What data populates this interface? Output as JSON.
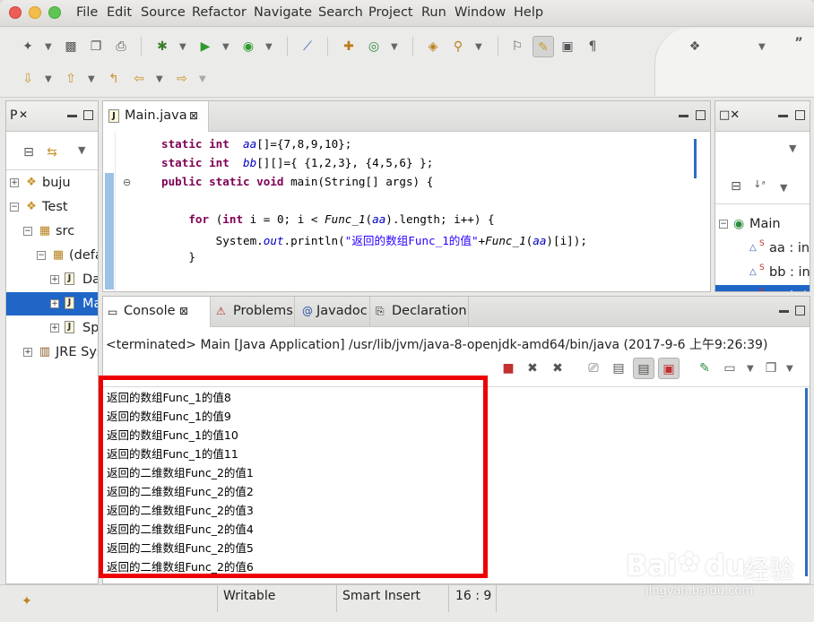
{
  "menu": [
    "File",
    "Edit",
    "Source",
    "Refactor",
    "Navigate",
    "Search",
    "Project",
    "Run",
    "Window",
    "Help"
  ],
  "left_panel": {
    "tab_label": "P",
    "tree": [
      {
        "label": "buju",
        "level": 0,
        "expander": "+"
      },
      {
        "label": "Test",
        "level": 0,
        "expander": "−"
      },
      {
        "label": "src",
        "level": 1,
        "expander": "−"
      },
      {
        "label": "(defa",
        "level": 2,
        "expander": "−"
      },
      {
        "label": "Da",
        "level": 3,
        "expander": "+"
      },
      {
        "label": "Ma",
        "level": 3,
        "expander": "+",
        "selected": true
      },
      {
        "label": "Sp",
        "level": 3,
        "expander": "+"
      },
      {
        "label": "JRE Sys",
        "level": 1,
        "expander": "+"
      }
    ]
  },
  "editor": {
    "tab_label": "Main.java",
    "lines": [
      {
        "segments": [
          {
            "t": "static ",
            "c": "kw"
          },
          {
            "t": "int ",
            "c": "kw"
          },
          {
            "t": " "
          },
          {
            "t": "aa",
            "c": "it"
          },
          {
            "t": "[]={7,8,9,10};"
          }
        ]
      },
      {
        "segments": [
          {
            "t": "static ",
            "c": "kw"
          },
          {
            "t": "int ",
            "c": "kw"
          },
          {
            "t": " "
          },
          {
            "t": "bb",
            "c": "it"
          },
          {
            "t": "[][]={ {1,2,3}, {4,5,6} };"
          }
        ]
      },
      {
        "segments": [
          {
            "t": "public ",
            "c": "kw"
          },
          {
            "t": "static ",
            "c": "kw"
          },
          {
            "t": "void ",
            "c": "kw"
          },
          {
            "t": "main(String[] args) {"
          }
        ]
      },
      {
        "segments": []
      },
      {
        "segments": [
          {
            "t": "    "
          },
          {
            "t": "for ",
            "c": "kw"
          },
          {
            "t": "("
          },
          {
            "t": "int ",
            "c": "kw"
          },
          {
            "t": "i = 0; i < "
          },
          {
            "t": "Func_1",
            "c": "fn"
          },
          {
            "t": "("
          },
          {
            "t": "aa",
            "c": "it"
          },
          {
            "t": ").length; i++) {"
          }
        ]
      },
      {
        "segments": [
          {
            "t": "        System."
          },
          {
            "t": "out",
            "c": "it"
          },
          {
            "t": ".println("
          },
          {
            "t": "\"返回的数组Func_1的值\"",
            "c": "st"
          },
          {
            "t": "+"
          },
          {
            "t": "Func_1",
            "c": "fn"
          },
          {
            "t": "("
          },
          {
            "t": "aa",
            "c": "it"
          },
          {
            "t": ")[i]);"
          }
        ]
      },
      {
        "segments": [
          {
            "t": "    }"
          }
        ]
      }
    ]
  },
  "outline": {
    "items": [
      {
        "label": "Main",
        "prefix": ""
      },
      {
        "label": "aa : in",
        "prefix": "S"
      },
      {
        "label": "bb : in",
        "prefix": "S"
      },
      {
        "label": "main(",
        "prefix": "S"
      }
    ]
  },
  "console": {
    "tabs": [
      "Console",
      "Problems",
      "Javadoc",
      "Declaration"
    ],
    "header": "<terminated> Main [Java Application] /usr/lib/jvm/java-8-openjdk-amd64/bin/java (2017-9-6 上午9:26:39)",
    "output": [
      "返回的数组Func_1的值8",
      "返回的数组Func_1的值9",
      "返回的数组Func_1的值10",
      "返回的数组Func_1的值11",
      "返回的二维数组Func_2的值1",
      "返回的二维数组Func_2的值2",
      "返回的二维数组Func_2的值3",
      "返回的二维数组Func_2的值4",
      "返回的二维数组Func_2的值5",
      "返回的二维数组Func_2的值6"
    ],
    "highlight_color": "#ee0000"
  },
  "status": {
    "writable": "Writable",
    "insert_mode": "Smart Insert",
    "position": "16 : 9"
  },
  "watermark": {
    "brand": "Bai",
    "brand2": "du",
    "suffix": "经验",
    "url": "jingyan.baidu.com"
  },
  "colors": {
    "selection": "#1f66c7",
    "keyword": "#7f0055",
    "string": "#2a00ff",
    "field": "#0000c0"
  }
}
